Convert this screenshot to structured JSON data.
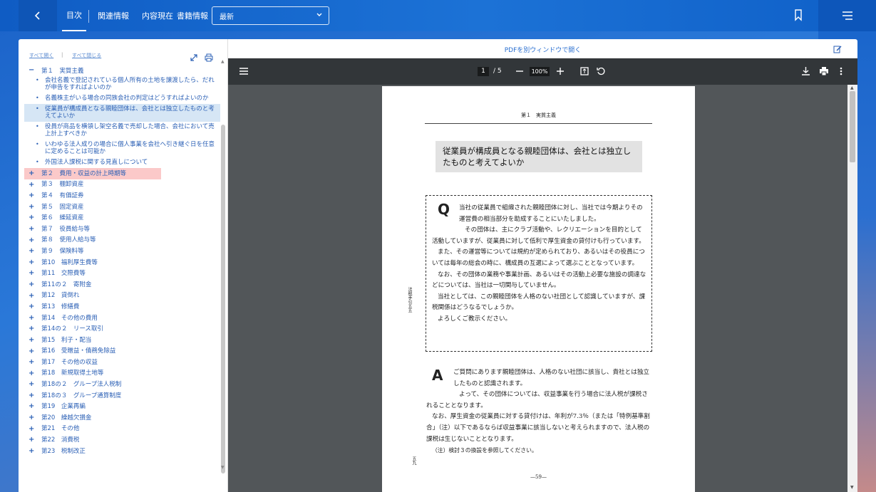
{
  "topbar": {
    "back_icon": "chevron-left-icon",
    "tabs": [
      "目次",
      "関連情報",
      "内容現在",
      "書籍情報"
    ],
    "version_select": "最新",
    "bookmark_icon": "bookmark-icon",
    "menu_icon": "hamburger-menu-icon"
  },
  "toc": {
    "expand_all": "すべて開く",
    "collapse_all": "すべて閉じる",
    "chapter1": "第１　実質主義",
    "subitems": [
      "会社名義で登記されている個人所有の土地を譲渡したら、だれが申告をすればよいのか",
      "名義株主がいる場合の同族会社の判定はどうすればよいのか",
      "従業員が構成員となる親睦団体は、会社とは独立したものと考えてよいか",
      "役員が商品を横領し架空名義で売却した場合、会社において売上計上すべきか",
      "いわゆる法人成りの場合に個人事業を会社へ引き継ぐ日を任意に定めることは可能か",
      "外国法人課税に関する見直しについて"
    ],
    "chapters": [
      "第２　費用・収益の計上時期等",
      "第３　棚卸資産",
      "第４　有価証券",
      "第５　固定資産",
      "第６　繰延資産",
      "第７　役員給与等",
      "第８　使用人給与等",
      "第９　保険料等",
      "第10　福利厚生費等",
      "第11　交際費等",
      "第11の２　寄附金",
      "第12　貸倒れ",
      "第13　修繕費",
      "第14　その他の費用",
      "第14の２　リース取引",
      "第15　利子・配当",
      "第16　受贈益・債務免除益",
      "第17　その他の収益",
      "第18　新規取得土地等",
      "第18の２　グループ法人税制",
      "第18の３　グループ通算制度",
      "第19　企業再編",
      "第20　繰越欠損金",
      "第21　その他",
      "第22　消費税",
      "第23　税制改正"
    ]
  },
  "pdf": {
    "open_link": "PDFを別ウィンドウで開く",
    "page_current": "1",
    "page_total": "/  5",
    "zoom": "100%",
    "header": "第１　実質主義",
    "title": "従業員が構成員となる親睦団体は、会社とは独立したものと考えてよいか",
    "q_letter": "Q",
    "question": [
      "当社の従業員で組織された親睦団体に対し、当社では今期よりその運営費の相当部分を助成することにいたしました。",
      "その団体は、主にクラブ活動や、レクリエーションを目的として活動していますが、従業員に対して低利で厚生資金の貸付けも行っています。",
      "また、その運営等については規約が定められており、あるいはその役員については毎年の総会の時に、構成員の互選によって選ぶこととなっています。",
      "なお、その団体の業務や事業計画、あるいはその活動上必要な施設の調達などについては、当社は一切関与していません。",
      "当社としては、この親睦団体を人格のない社団として認識していますが、課税関係はどうなるでしょうか。",
      "よろしくご教示ください。"
    ],
    "a_letter": "A",
    "answer": [
      "ご質問にあります親睦団体は、人格のない社団に該当し、貴社とは独立したものと認識されます。",
      "よって、その団体については、収益事業を行う場合に法人税が課税されることとなります。",
      "なお、厚生資金の従業員に対する貸付けは、年利が7.3％（または「特例基準割合」（注）以下であるならば収益事業に該当しないと考えられますので、法人税の課税は生じないこととなります。"
    ],
    "note": "（注）検討３の換設を参照してください。",
    "side_text": "法税手引五五",
    "side_text2": "五九",
    "page_number": "—59—"
  }
}
